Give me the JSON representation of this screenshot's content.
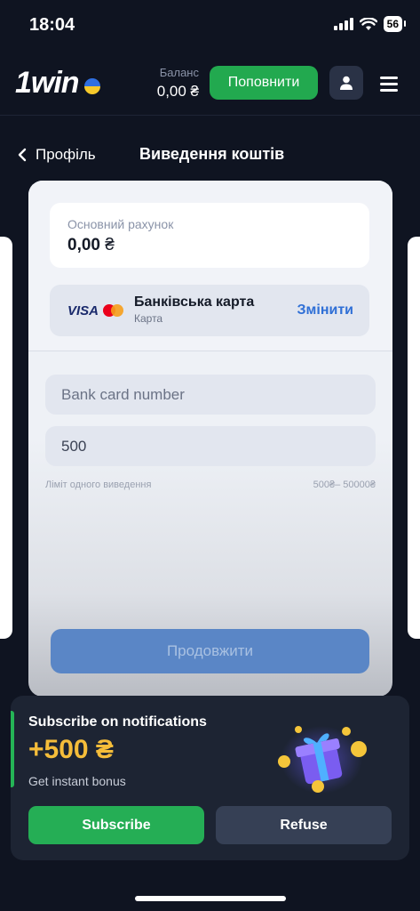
{
  "status_bar": {
    "time": "18:04",
    "battery": "56"
  },
  "header": {
    "logo_text": "1win",
    "balance_label": "Баланс",
    "balance_value": "0,00 ₴",
    "deposit_label": "Поповнити"
  },
  "page": {
    "back_label": "Профіль",
    "title": "Виведення коштів"
  },
  "withdraw": {
    "account_label": "Основний рахунок",
    "account_value": "0,00",
    "currency": "₴",
    "method_brand": "VISA",
    "method_title": "Банківська карта",
    "method_sub": "Карта",
    "change_label": "Змінити",
    "card_placeholder": "Bank card number",
    "amount_value": "500",
    "limit_label": "Ліміт одного виведення",
    "limit_value": "500₴– 50000₴",
    "continue_label": "Продовжити"
  },
  "notification": {
    "title": "Subscribe on notifications",
    "bonus": "+500 ₴",
    "subtitle": "Get instant bonus",
    "subscribe_label": "Subscribe",
    "refuse_label": "Refuse"
  },
  "colors": {
    "background": "#0f1421",
    "accent_green": "#22a94f",
    "link_blue": "#2f6fd6",
    "bonus_gold": "#f5bd3a"
  }
}
